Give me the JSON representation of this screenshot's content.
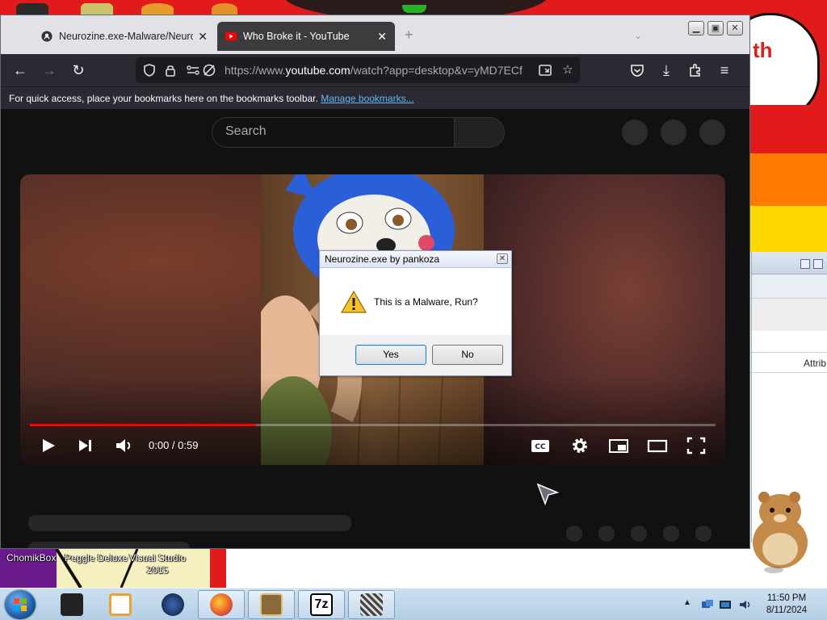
{
  "desktop": {
    "bubble_text": "th",
    "icons": [
      {
        "label": "ChomikBox"
      },
      {
        "label": "Peggle Deluxe"
      },
      {
        "label": "Visual Studio 2015"
      }
    ],
    "right_window": {
      "column_header": "Attrib"
    }
  },
  "browser": {
    "tabs": [
      {
        "label": "Neurozine.exe-Malware/Neurozine",
        "favicon": "github-icon",
        "active": false
      },
      {
        "label": "Who Broke it - YouTube",
        "favicon": "youtube-icon",
        "active": true
      }
    ],
    "url": {
      "prefix": "https://www.",
      "domain": "youtube.com",
      "rest": "/watch?app=desktop&v=yMD7ECf"
    },
    "bookmarks_bar": {
      "text": "For quick access, place your bookmarks here on the bookmarks toolbar.",
      "link": "Manage bookmarks..."
    }
  },
  "youtube": {
    "search_placeholder": "Search",
    "player": {
      "time": "0:00 / 0:59",
      "progress": 0.33
    }
  },
  "dialog": {
    "title": "Neurozine.exe by pankoza",
    "message": "This is a Malware, Run?",
    "yes_label": "Yes",
    "no_label": "No",
    "close_glyph": "✕"
  },
  "taskbar": {
    "apps": [
      {
        "name": "app-dark-box",
        "color": "#222222"
      },
      {
        "name": "media-player",
        "color": "#f0a030"
      },
      {
        "name": "earth-app",
        "color": "#1a3a6a"
      },
      {
        "name": "firefox",
        "color": "#e8602c"
      },
      {
        "name": "chomikbox",
        "color": "#8a6a3a"
      },
      {
        "name": "7zip",
        "color": "#ffffff"
      },
      {
        "name": "qr-app",
        "color": "#9a9a9a"
      }
    ],
    "time": "11:50 PM",
    "date": "8/11/2024"
  }
}
